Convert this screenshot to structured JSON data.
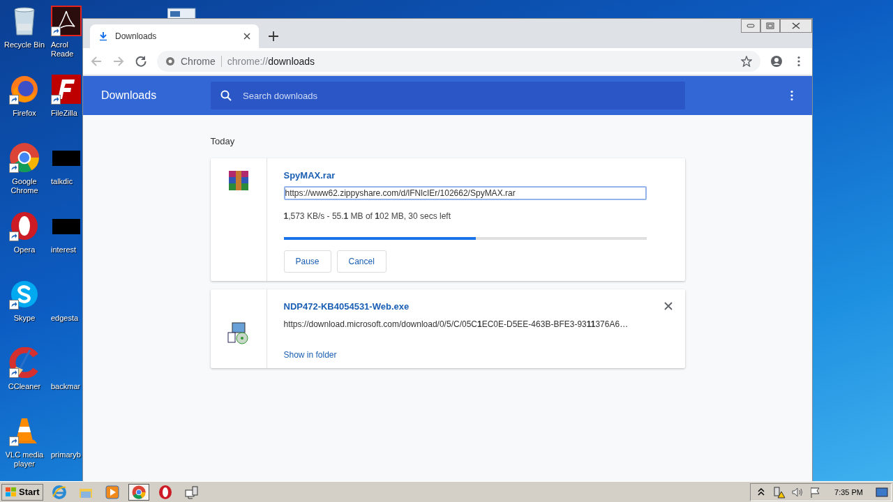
{
  "desktop": {
    "column_1": [
      {
        "label": "Recycle Bin",
        "kind": "recycle",
        "shortcut": false
      },
      {
        "label": "Firefox",
        "kind": "firefox",
        "shortcut": true
      },
      {
        "label": "Google Chrome",
        "kind": "chrome",
        "shortcut": true
      },
      {
        "label": "Opera",
        "kind": "opera",
        "shortcut": true
      },
      {
        "label": "Skype",
        "kind": "skype",
        "shortcut": true
      },
      {
        "label": "CCleaner",
        "kind": "ccleaner",
        "shortcut": true
      },
      {
        "label": "VLC media player",
        "kind": "vlc",
        "shortcut": true
      }
    ],
    "column_2": [
      {
        "label": "Acrol Reade",
        "kind": "acrobat",
        "shortcut": true
      },
      {
        "label": "FileZilla",
        "kind": "filezilla",
        "shortcut": true
      },
      {
        "label": "talkdic",
        "kind": "black",
        "shortcut": false
      },
      {
        "label": "interest",
        "kind": "black",
        "shortcut": false
      },
      {
        "label": "edgesta",
        "kind": "blank",
        "shortcut": false
      },
      {
        "label": "backmar",
        "kind": "blank",
        "shortcut": false
      },
      {
        "label": "primaryb",
        "kind": "blank",
        "shortcut": false
      }
    ]
  },
  "window": {
    "tabs": [
      {
        "title": "Downloads",
        "selected": true
      }
    ],
    "omnibox": {
      "site_label": "Chrome",
      "url_scheme": "chrome://",
      "url_path": "downloads"
    },
    "page": {
      "title": "Downloads",
      "search": {
        "placeholder": "Search downloads"
      },
      "section": "Today",
      "downloads": [
        {
          "kind": "in_progress",
          "name": "SpyMAX.rar",
          "url": "https://www62.zippyshare.com/d/lFNlcIEr/102662/SpyMAX.rar",
          "url_focused": true,
          "status": "**1**,573 KB/s - 55.**1** MB of **1**02 MB, 30 secs left",
          "level": 0.53,
          "buttons": [
            "Pause",
            "Cancel"
          ]
        },
        {
          "kind": "complete",
          "name": "NDP472-KB4054531-Web.exe",
          "url": "https://download.microsoft.com/download/0/5/C/05C**1**EC0E-D5EE-463B-BFE3-93**11**376A6…",
          "url_focused": false,
          "link": "Show in folder",
          "removable": true
        }
      ]
    }
  },
  "taskbar": {
    "start": "Start",
    "apps": [
      {
        "kind": "ie",
        "selected": false
      },
      {
        "kind": "explorer",
        "selected": false
      },
      {
        "kind": "media",
        "selected": false
      },
      {
        "kind": "chrome",
        "selected": true
      },
      {
        "kind": "opera",
        "selected": false
      },
      {
        "kind": "desktop",
        "selected": false
      }
    ],
    "clock": "7:35 PM"
  }
}
